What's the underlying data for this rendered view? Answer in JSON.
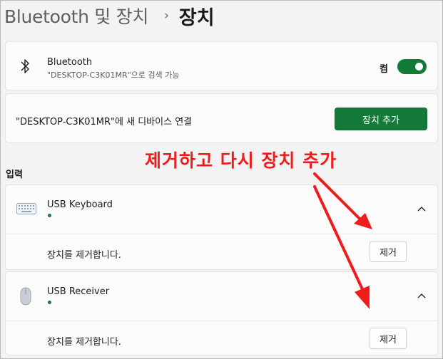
{
  "breadcrumb": {
    "parent": "Bluetooth 및 장치",
    "separator": "›",
    "current": "장치"
  },
  "bluetooth": {
    "title": "Bluetooth",
    "subtitle": "\"DESKTOP-C3K01MR\"으로 검색 가능",
    "toggle_label": "켬",
    "toggle_on": true
  },
  "add_device": {
    "text": "\"DESKTOP-C3K01MR\"에 새 디바이스 연결",
    "button_label": "장치 추가"
  },
  "annotation": {
    "text": "제거하고 다시 장치 추가",
    "color": "#ee1c1c"
  },
  "section": {
    "label": "입력"
  },
  "devices": [
    {
      "name": "USB Keyboard",
      "icon": "keyboard-icon",
      "remove_text": "장치를 제거합니다.",
      "remove_button": "제거"
    },
    {
      "name": "USB Receiver",
      "icon": "mouse-icon",
      "remove_text": "장치를 제거합니다.",
      "remove_button": "제거"
    }
  ],
  "colors": {
    "accent": "#137a3a",
    "annotation": "#ee1c1c"
  }
}
